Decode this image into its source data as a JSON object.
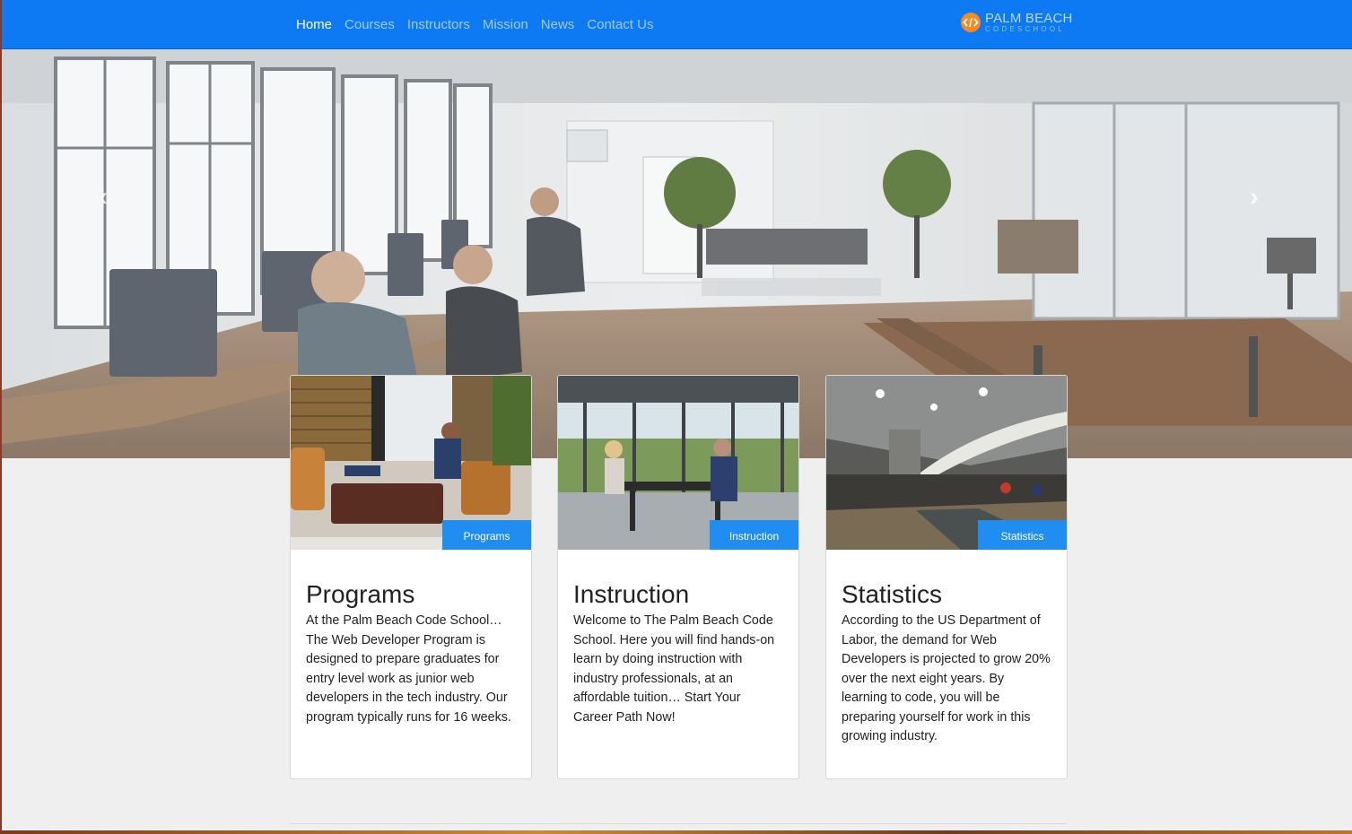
{
  "nav": {
    "links": [
      {
        "label": "Home",
        "active": true
      },
      {
        "label": "Courses",
        "active": false
      },
      {
        "label": "Instructors",
        "active": false
      },
      {
        "label": "Mission",
        "active": false
      },
      {
        "label": "News",
        "active": false
      },
      {
        "label": "Contact Us",
        "active": false
      }
    ],
    "brand": {
      "line1": "PALM BEACH",
      "line2": "CODESCHOOL"
    }
  },
  "hero": {
    "prev_icon": "chevron-left-icon",
    "next_icon": "chevron-right-icon"
  },
  "cards": [
    {
      "badge": "Programs",
      "title": "Programs",
      "text": "At the Palm Beach Code School… The Web Developer Program is designed to prepare graduates for entry level work as junior web developers in the tech industry. Our program typically runs for 16 weeks."
    },
    {
      "badge": "Instruction",
      "title": "Instruction",
      "text": "Welcome to The Palm Beach Code School. Here you will find hands-on learn by doing instruction with industry professionals, at an affordable tuition… Start Your Career Path Now!"
    },
    {
      "badge": "Statistics",
      "title": "Statistics",
      "text": "According to the US Department of Labor, the demand for Web Developers is projected to grow 20% over the next eight years. By learning to code, you will be preparing yourself for work in this growing industry."
    }
  ],
  "colors": {
    "navbar": "#0d79f2",
    "badge": "#1f8ef0",
    "logo_orange": "#f58a1f"
  }
}
